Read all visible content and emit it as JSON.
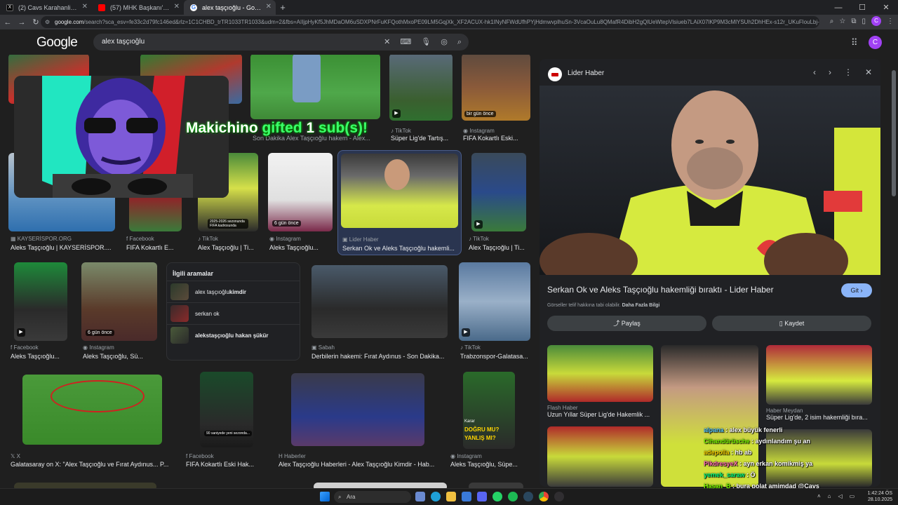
{
  "tabs": [
    {
      "label": "(2) Cavs Karahanli zr (@cerrahpa...",
      "icon": "x-icon",
      "color": "#ffffff",
      "active": false
    },
    {
      "label": "(57) MHK Başkanı'nın da bahsettiği...",
      "icon": "youtube-icon",
      "color": "#ff0000",
      "active": false
    },
    {
      "label": "alex taşçıoğlu - Google'da Ara",
      "icon": "google-icon",
      "color": "#4285f4",
      "active": true
    }
  ],
  "address": {
    "host": "google.com",
    "path": "/search?sca_esv=fe33c2d79fc146ed&rlz=1C1CHBD_trTR1033TR1033&udm=2&fbs=AIIjpHyKf5JhMDaOM6uSDXPNrFuKFQothMxoPE09LM5GqjXk_XF2ACUX-hk1INyNFWdUfhPYjHdmwvplhuSn-3VcaOuLu8QMafR4DibH2gQlUeWtepVlsiueb7LAiX07lKP9M3cMlYSUh2DhHEx-s12r_UKuFlouLbj-UMZzneGVFgUrvwjVl5tPstaKR2i9B1iGAwr7-hK..."
  },
  "search": {
    "query": "alex taşçıoğlu"
  },
  "logo": "Google",
  "avatar_letter": "C",
  "overlay_text": {
    "user": "Makichino",
    "gifted": " gifted ",
    "count": "1",
    "unit": " sub(s)!"
  },
  "grid": {
    "row0": [
      {
        "source": "",
        "title": "S..."
      },
      {
        "source": "",
        "title": "Son Dakika Alex Taşçıoğlu hakem - Alex..."
      },
      {
        "source": "TikTok",
        "title": "Süper Lig'de Tartış..."
      },
      {
        "source": "Instagram",
        "title": "FIFA Kokartlı Eski...",
        "badge": "bir gün önce"
      }
    ],
    "row1": [
      {
        "source": "KAYSERİSPOR.ORG",
        "title": "Aleks Taşçıoğlu | KAYSERİSPOR...."
      },
      {
        "source": "Facebook",
        "title": "FIFA Kokartlı E..."
      },
      {
        "source": "TikTok",
        "title": "Alex Taşçıoğlu | Ti...",
        "badge": "2025-2026 sezonunda FIFA kadrosunda"
      },
      {
        "source": "Instagram",
        "title": "Aleks Taşçıoğlu...",
        "badge": "6 gün önce"
      },
      {
        "source": "Lider Haber",
        "title": "Serkan Ok ve Aleks Taşçıoğlu hakemli..."
      },
      {
        "source": "TikTok",
        "title": "Alex Taşçıoğlu | Ti..."
      }
    ],
    "row2": [
      {
        "source": "Facebook",
        "title": "Aleks Taşçıoğlu..."
      },
      {
        "source": "Instagram",
        "title": "Aleks Taşçıoğlu, Sü...",
        "badge": "6 gün önce"
      },
      {
        "source": "Sabah",
        "title": "Derbilerin hakemi: Fırat Aydınus - Son Dakika..."
      },
      {
        "source": "TikTok",
        "title": "Trabzonspor-Galatasa..."
      }
    ],
    "row3": [
      {
        "source": "X",
        "title": "Galatasaray on X: \"Alex Taşçıoğlu ve Fırat Aydınus... P..."
      },
      {
        "source": "Facebook",
        "title": "FIFA Kokartlı Eski Hak...",
        "badge": "90 saniyede yeni sezonda..."
      },
      {
        "source": "Haberler",
        "title": "Alex Taşçıoğlu Haberleri - Alex Taşçıoğlu Kimdir - Hab..."
      },
      {
        "source": "Instagram",
        "title": "Aleks Taşçıoğlu, Süpe...",
        "overlay1": "Karar",
        "overlay2": "DOĞRU MU?",
        "overlay3": "YANLIŞ MI?"
      }
    ]
  },
  "related": {
    "heading": "İlgili aramalar",
    "items": [
      {
        "prefix": "alex taşçıoğlu ",
        "bold": "kimdir"
      },
      {
        "prefix": "serkan ok",
        "bold": ""
      },
      {
        "prefix": "aleks",
        "bold": " taşçıoğlu hakan şükür"
      }
    ]
  },
  "panel": {
    "source": "Lider Haber",
    "title": "Serkan Ok ve Aleks Taşçıoğlu hakemliği bıraktı - Lider Haber",
    "goto": "Git",
    "copyright": "Görseller telif hakkına tabi olabilir.",
    "more_info": "Daha Fazla Bilgi",
    "share": "Paylaş",
    "save": "Kaydet",
    "related": [
      {
        "source": "Flash Haber",
        "title": "Uzun Yıllar Süper Lig'de Hakemlik ..."
      },
      {
        "source": "Haber Meydan",
        "title": "Süper Lig'de, 2 isim hakemliği bıra..."
      }
    ]
  },
  "chat": [
    {
      "user": "alpana",
      "msg": " : alex büyük fenerli"
    },
    {
      "user": "Cihandürüsche",
      "msg": " : aydınlandım şu an"
    },
    {
      "user": "adepolla",
      "msg": " : hb ab"
    },
    {
      "user": "PikdresyeX",
      "msg": " : ayn erkan komikmiş ya"
    },
    {
      "user": "yemek_saraw",
      "msg": " : Ö"
    },
    {
      "user": "Hasan_B",
      "msg": " : bura polat amimdad @Cavs"
    }
  ],
  "taskbar": {
    "search": "Ara",
    "time": "1:42:24 ÖS",
    "date": "28.10.2025"
  },
  "colors": {
    "accent": "#8ab4f8",
    "background": "#1f1f1f",
    "panel": "#202124"
  }
}
